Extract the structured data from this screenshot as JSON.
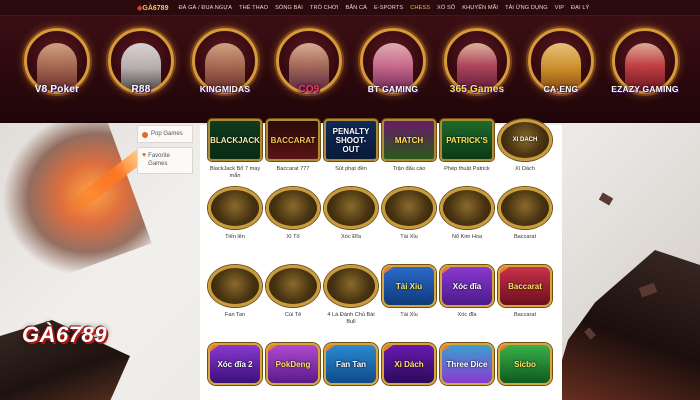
{
  "nav": {
    "logo": "GÀ6789",
    "items": [
      {
        "label": "ĐÁ GÀ / ĐUA NGỰA",
        "active": false
      },
      {
        "label": "THỂ THAO",
        "active": false
      },
      {
        "label": "SÒNG BÀI",
        "active": false
      },
      {
        "label": "TRÒ CHƠI",
        "active": false
      },
      {
        "label": "BẮN CÁ",
        "active": false
      },
      {
        "label": "E-SPORTS",
        "active": false
      },
      {
        "label": "CHESS",
        "active": true
      },
      {
        "label": "XỔ SỐ",
        "active": false
      },
      {
        "label": "KHUYẾN MÃI",
        "active": false
      },
      {
        "label": "TẢI ỨNG DỤNG",
        "active": false
      },
      {
        "label": "VIP",
        "active": false
      },
      {
        "label": "ĐẠI LÝ",
        "active": false
      }
    ]
  },
  "providers": [
    {
      "name": "V8 Poker"
    },
    {
      "name": "R88"
    },
    {
      "name": "KINGMIDAS"
    },
    {
      "name": "CQ9"
    },
    {
      "name": "BT GAMING"
    },
    {
      "name": "365 Games"
    },
    {
      "name": "CA·ENG"
    },
    {
      "name": "EZAZY GAMING"
    }
  ],
  "sidebar": {
    "items": [
      {
        "label": "Pop Games"
      },
      {
        "label": "Favorite Games"
      }
    ]
  },
  "games": [
    {
      "name": "BlackJack Bổ 7 may mắn",
      "thumb": "BLACKJACK"
    },
    {
      "name": "Baccarat 777",
      "thumb": "BACCARAT"
    },
    {
      "name": "Sút phạt đền",
      "thumb": "PENALTY SHOOT-OUT"
    },
    {
      "name": "Trận đấu cào",
      "thumb": "MATCH"
    },
    {
      "name": "Phép thuật Patrick",
      "thumb": "PATRICK'S"
    },
    {
      "name": "Xì Dách",
      "thumb": "XI DACH"
    },
    {
      "name": "Tiến lên",
      "thumb": ""
    },
    {
      "name": "Xì Tố",
      "thumb": ""
    },
    {
      "name": "Xóc Đĩa",
      "thumb": ""
    },
    {
      "name": "Tài Xỉu",
      "thumb": ""
    },
    {
      "name": "Nổ Kim Hoa",
      "thumb": ""
    },
    {
      "name": "Baccarat",
      "thumb": ""
    },
    {
      "name": "Fan Tan",
      "thumb": ""
    },
    {
      "name": "Cùi Tê",
      "thumb": ""
    },
    {
      "name": "4 Lá Đánh Chủ Bài Bull",
      "thumb": ""
    },
    {
      "name": "Tài Xỉu",
      "thumb": "Tài Xỉu"
    },
    {
      "name": "Xóc đĩa",
      "thumb": "Xóc đĩa"
    },
    {
      "name": "Baccarat",
      "thumb": "Baccarat"
    },
    {
      "name": "",
      "thumb": "Xóc đĩa 2"
    },
    {
      "name": "",
      "thumb": "PokDeng"
    },
    {
      "name": "",
      "thumb": "Fan Tan"
    },
    {
      "name": "",
      "thumb": "Xì Dách"
    },
    {
      "name": "",
      "thumb": "Three Dice"
    },
    {
      "name": "",
      "thumb": "Sicbo"
    }
  ],
  "brand": {
    "logo": "GÀ6789"
  }
}
